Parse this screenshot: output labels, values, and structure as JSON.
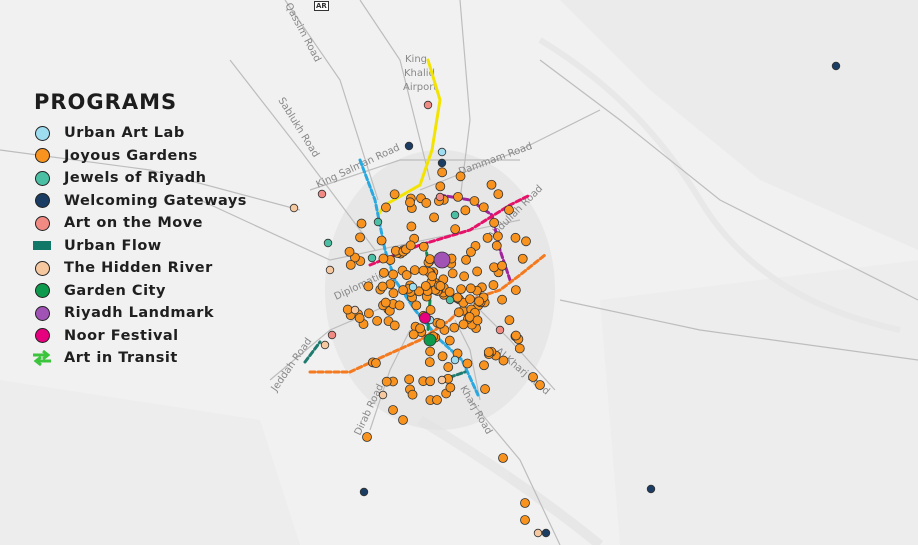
{
  "legend": {
    "title": "PROGRAMS",
    "items": [
      {
        "label": "Urban Art Lab",
        "symbol": "dot",
        "color": "#9edcf0"
      },
      {
        "label": "Joyous Gardens",
        "symbol": "dot",
        "color": "#f7931e"
      },
      {
        "label": "Jewels of Riyadh",
        "symbol": "dot",
        "color": "#4bbfa3"
      },
      {
        "label": "Welcoming Gateways",
        "symbol": "dot",
        "color": "#1b3d63"
      },
      {
        "label": "Art on the Move",
        "symbol": "dot",
        "color": "#f08a82"
      },
      {
        "label": "Urban Flow",
        "symbol": "flow",
        "color": "#117766"
      },
      {
        "label": "The Hidden River",
        "symbol": "dot",
        "color": "#f5c8a0"
      },
      {
        "label": "Garden City",
        "symbol": "dot",
        "color": "#0e9a4c"
      },
      {
        "label": "Riyadh Landmark",
        "symbol": "dot",
        "color": "#a052b5"
      },
      {
        "label": "Noor Festival",
        "symbol": "dot",
        "color": "#e6007e"
      },
      {
        "label": "Art in Transit",
        "symbol": "transit",
        "color": "#3cc43c"
      }
    ]
  },
  "map_badge": "AR",
  "road_labels": [
    "Qassim Road",
    "Sablukh Road",
    "King Salman Road",
    "Dammam Road",
    "King Khalid Airport",
    "Diplomatic",
    "Jeddah Road",
    "Dirab Road",
    "Kharj Road",
    "Al Kharj Road",
    "Abdullah Road"
  ]
}
